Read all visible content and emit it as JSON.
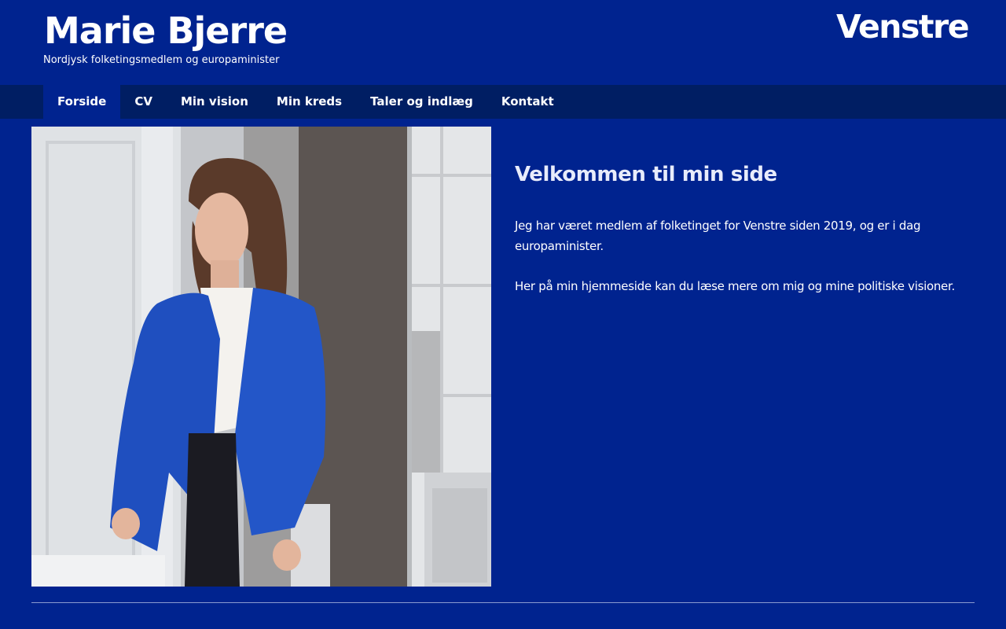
{
  "header": {
    "title": "Marie Bjerre",
    "subtitle": "Nordjysk folketingsmedlem og europaminister",
    "logo_text": "Venstre"
  },
  "nav": {
    "items": [
      {
        "label": "Forside",
        "active": true
      },
      {
        "label": "CV"
      },
      {
        "label": "Min vision"
      },
      {
        "label": "Min kreds"
      },
      {
        "label": "Taler og indlæg"
      },
      {
        "label": "Kontakt"
      }
    ]
  },
  "main": {
    "heading": "Velkommen til min side",
    "paragraphs": [
      "Jeg har været medlem af folketinget for Venstre siden 2019, og er i dag europaminister.",
      "Her på min hjemmeside kan du læse mere om mig og mine politiske visioner."
    ]
  },
  "colors": {
    "background": "#00238f",
    "nav_background": "#001e63",
    "active_nav": "#00238f",
    "text": "#ffffff"
  }
}
